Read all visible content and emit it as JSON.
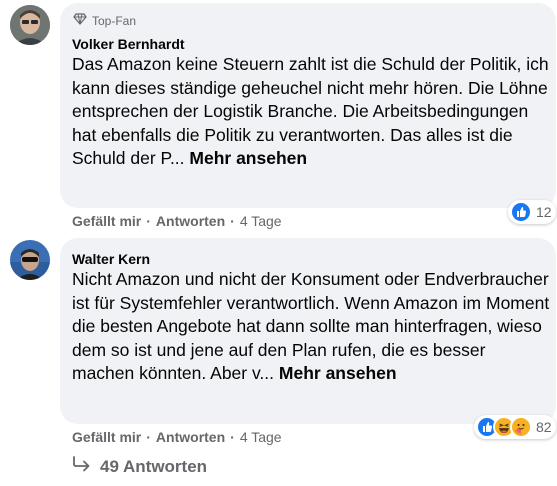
{
  "comments": [
    {
      "badge": "Top-Fan",
      "author": "Volker Bernhardt",
      "text": "Das Amazon keine Steuern zahlt ist die Schuld der Politik, ich kann dieses ständige geheuchel nicht mehr hören. Die Löhne entsprechen der Logistik Branche. Die Arbeitsbedingungen hat ebenfalls die Politik zu verantworten. Das alles ist die Schuld der P...",
      "more_label": "Mehr ansehen",
      "like_label": "Gefällt mir",
      "reply_label": "Antworten",
      "time": "4 Tage",
      "reaction_count": "12",
      "reaction_icons": [
        "like-icon"
      ]
    },
    {
      "author": "Walter Kern",
      "text": "Nicht Amazon und nicht der Konsument oder Endverbraucher ist für Systemfehler verantwortlich. Wenn Amazon im Moment die besten Angebote hat dann sollte man hinterfragen, wieso dem so ist und jene auf den Plan rufen, die es besser machen könnten. Aber v...",
      "more_label": "Mehr ansehen",
      "like_label": "Gefällt mir",
      "reply_label": "Antworten",
      "time": "4 Tage",
      "reaction_count": "82",
      "reaction_icons": [
        "like-icon",
        "haha-icon",
        "care-icon"
      ]
    }
  ],
  "replies_link": {
    "label": "49 Antworten",
    "icon": "reply-arrow-icon"
  },
  "colors": {
    "bubble": "#f0f2f5",
    "secondary_text": "#65676b",
    "like_blue": "#1877f2",
    "haha_yellow": "#f7b125"
  }
}
